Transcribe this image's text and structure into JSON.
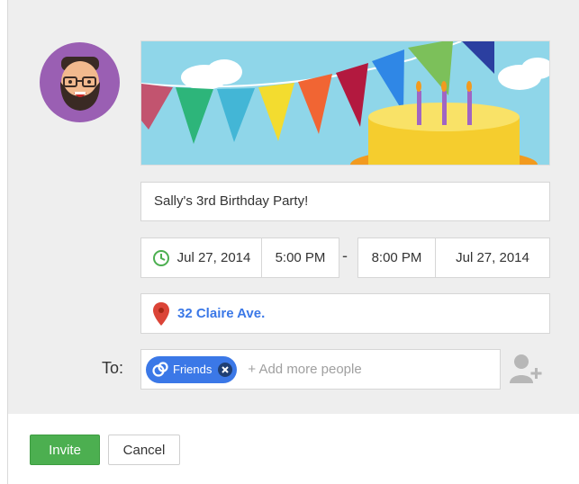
{
  "event": {
    "title": "Sally's 3rd Birthday Party!",
    "start_date": "Jul 27, 2014",
    "start_time": "5:00 PM",
    "separator": "-",
    "end_time": "8:00 PM",
    "end_date": "Jul 27, 2014",
    "location": "32 Claire Ave."
  },
  "invite": {
    "to_label": "To:",
    "chip_label": "Friends",
    "placeholder": "+ Add more people"
  },
  "actions": {
    "invite_label": "Invite",
    "cancel_label": "Cancel"
  },
  "icons": {
    "clock": "clock-icon",
    "location": "map-pin-icon",
    "circles": "google-circles-icon",
    "chip_remove": "close-circle-icon",
    "add_person": "add-person-icon"
  },
  "colors": {
    "accent_blue": "#3b78e7",
    "invite_green": "#4caf50",
    "clock_green": "#4caf50",
    "pin_red": "#db4437",
    "avatar_purple": "#9a5fb3",
    "banner_sky": "#8fd6e9"
  }
}
